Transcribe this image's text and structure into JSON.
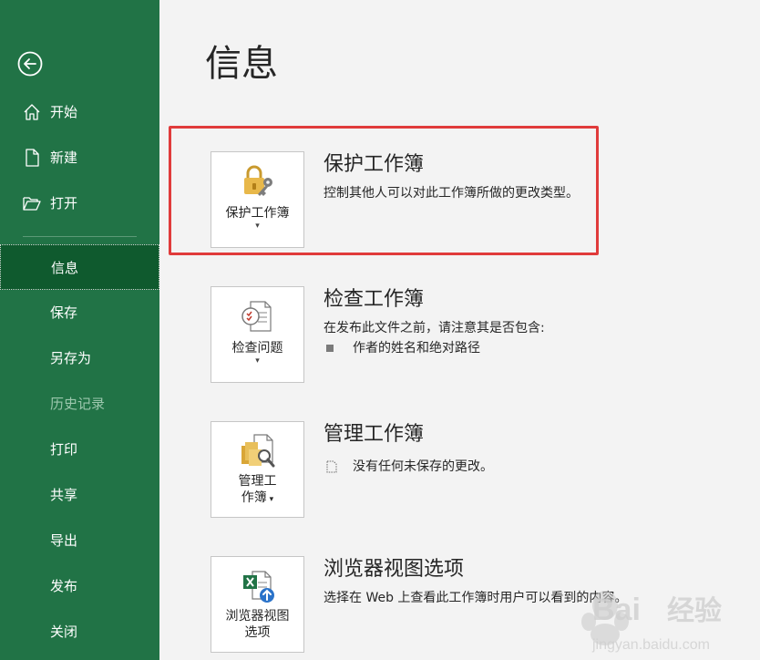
{
  "sidebar": {
    "items": [
      {
        "label": "开始"
      },
      {
        "label": "新建"
      },
      {
        "label": "打开"
      },
      {
        "label": "信息"
      },
      {
        "label": "保存"
      },
      {
        "label": "另存为"
      },
      {
        "label": "历史记录"
      },
      {
        "label": "打印"
      },
      {
        "label": "共享"
      },
      {
        "label": "导出"
      },
      {
        "label": "发布"
      },
      {
        "label": "关闭"
      }
    ]
  },
  "main": {
    "title": "信息",
    "sections": [
      {
        "tile_label": "保护工作簿",
        "title": "保护工作簿",
        "description": "控制其他人可以对此工作簿所做的更改类型。"
      },
      {
        "tile_label": "检查问题",
        "title": "检查工作簿",
        "description": "在发布此文件之前，请注意其是否包含:",
        "bullet": "作者的姓名和绝对路径"
      },
      {
        "tile_label_line1": "管理工",
        "tile_label_line2": "作簿",
        "title": "管理工作簿",
        "bullet": "没有任何未保存的更改。"
      },
      {
        "tile_label_line1": "浏览器视图",
        "tile_label_line2": "选项",
        "title": "浏览器视图选项",
        "description": "选择在 Web 上查看此工作簿时用户可以看到的内容。"
      }
    ]
  },
  "watermark": {
    "text": "经验",
    "url": "jingyan.baidu.com"
  },
  "colors": {
    "sidebar": "#217346",
    "active": "#0f5a2e",
    "highlight": "#e03b3b"
  }
}
